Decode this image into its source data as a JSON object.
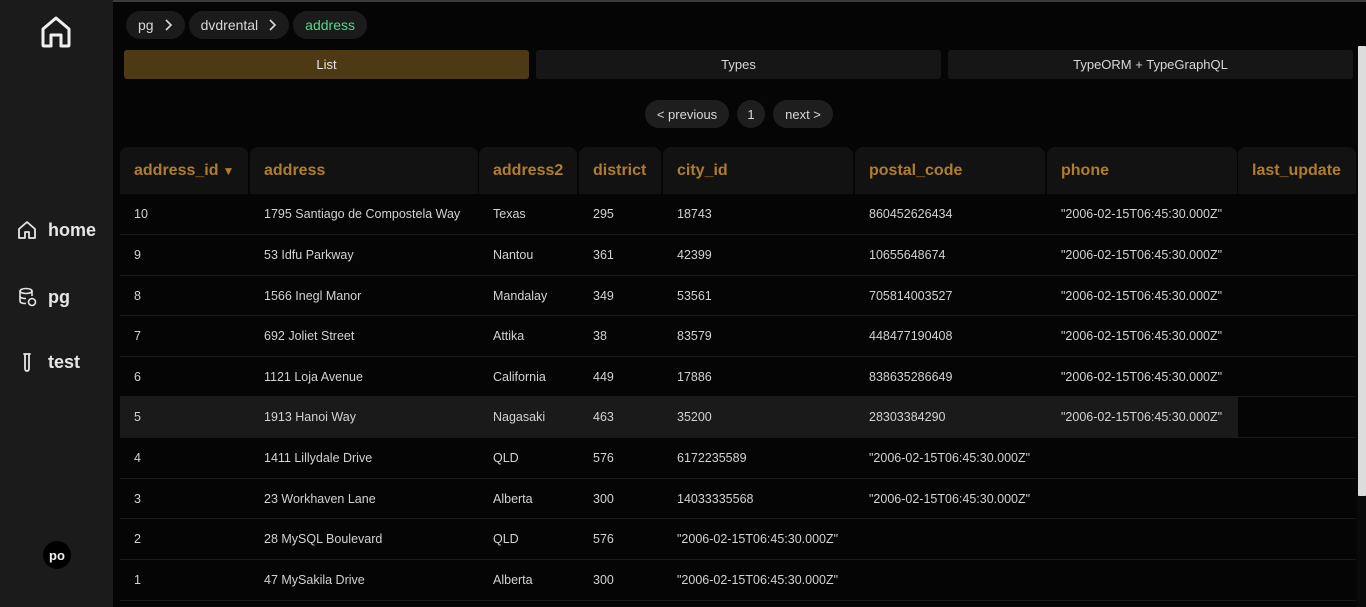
{
  "sidebar": {
    "items": [
      {
        "label": "home",
        "icon": "home-icon"
      },
      {
        "label": "pg",
        "icon": "database-icon"
      },
      {
        "label": "test",
        "icon": "test-tube-icon"
      }
    ],
    "avatar": "po"
  },
  "breadcrumb": [
    "pg",
    "dvdrental",
    "address"
  ],
  "tabs": [
    "List",
    "Types",
    "TypeORM + TypeGraphQL"
  ],
  "pager": {
    "previous": "< previous",
    "page": "1",
    "next": "next >"
  },
  "table": {
    "columns": [
      "address_id",
      "address",
      "address2",
      "district",
      "city_id",
      "postal_code",
      "phone",
      "last_update"
    ],
    "sort_indicator": "▼",
    "rows": [
      [
        "10",
        "1795 Santiago de Compostela Way",
        "Texas",
        "295",
        "18743",
        "860452626434",
        "\"2006-02-15T06:45:30.000Z\"",
        ""
      ],
      [
        "9",
        "53 Idfu Parkway",
        "Nantou",
        "361",
        "42399",
        "10655648674",
        "\"2006-02-15T06:45:30.000Z\"",
        ""
      ],
      [
        "8",
        "1566 Inegl Manor",
        "Mandalay",
        "349",
        "53561",
        "705814003527",
        "\"2006-02-15T06:45:30.000Z\"",
        ""
      ],
      [
        "7",
        "692 Joliet Street",
        "Attika",
        "38",
        "83579",
        "448477190408",
        "\"2006-02-15T06:45:30.000Z\"",
        ""
      ],
      [
        "6",
        "1121 Loja Avenue",
        "California",
        "449",
        "17886",
        "838635286649",
        "\"2006-02-15T06:45:30.000Z\"",
        ""
      ],
      [
        "5",
        "1913 Hanoi Way",
        "Nagasaki",
        "463",
        "35200",
        "28303384290",
        "\"2006-02-15T06:45:30.000Z\"",
        ""
      ],
      [
        "4",
        "1411 Lillydale Drive",
        "QLD",
        "576",
        "6172235589",
        "\"2006-02-15T06:45:30.000Z\"",
        "",
        ""
      ],
      [
        "3",
        "23 Workhaven Lane",
        "Alberta",
        "300",
        "14033335568",
        "\"2006-02-15T06:45:30.000Z\"",
        "",
        ""
      ],
      [
        "2",
        "28 MySQL Boulevard",
        "QLD",
        "576",
        "\"2006-02-15T06:45:30.000Z\"",
        "",
        "",
        ""
      ],
      [
        "1",
        "47 MySakila Drive",
        "Alberta",
        "300",
        "\"2006-02-15T06:45:30.000Z\"",
        "",
        "",
        ""
      ]
    ]
  },
  "colors": {
    "accent": "#b07d2e",
    "active_tab": "#4d3a15",
    "breadcrumb_active": "#54d890",
    "sidebar_bg": "#1c1b1b"
  }
}
